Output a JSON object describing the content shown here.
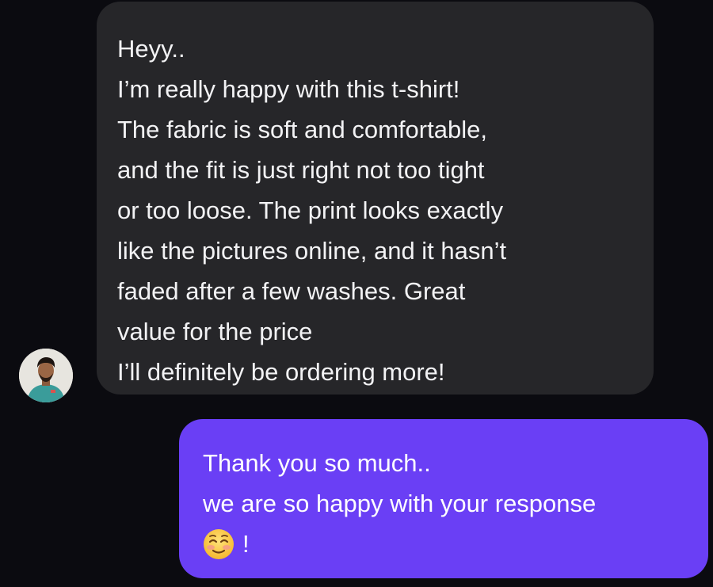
{
  "conversation": {
    "incoming": {
      "lines": [
        "Heyy..",
        "I’m really happy with this t-shirt!",
        "The fabric is soft and comfortable,",
        "and the fit is just right not too tight",
        "or too loose. The print looks exactly",
        "like the pictures online, and it hasn’t",
        "faded after a few washes. Great",
        "value for the price",
        "I’ll definitely be ordering more!"
      ],
      "avatar_icon": "person-avatar-icon",
      "bubble_color": "#262629"
    },
    "outgoing": {
      "lines": [
        "Thank you so much..",
        "we are so happy with your response"
      ],
      "emoji_icon": "smiling-face-emoji-icon",
      "trailing_text": "!",
      "bubble_color": "#6a3ff5"
    }
  }
}
